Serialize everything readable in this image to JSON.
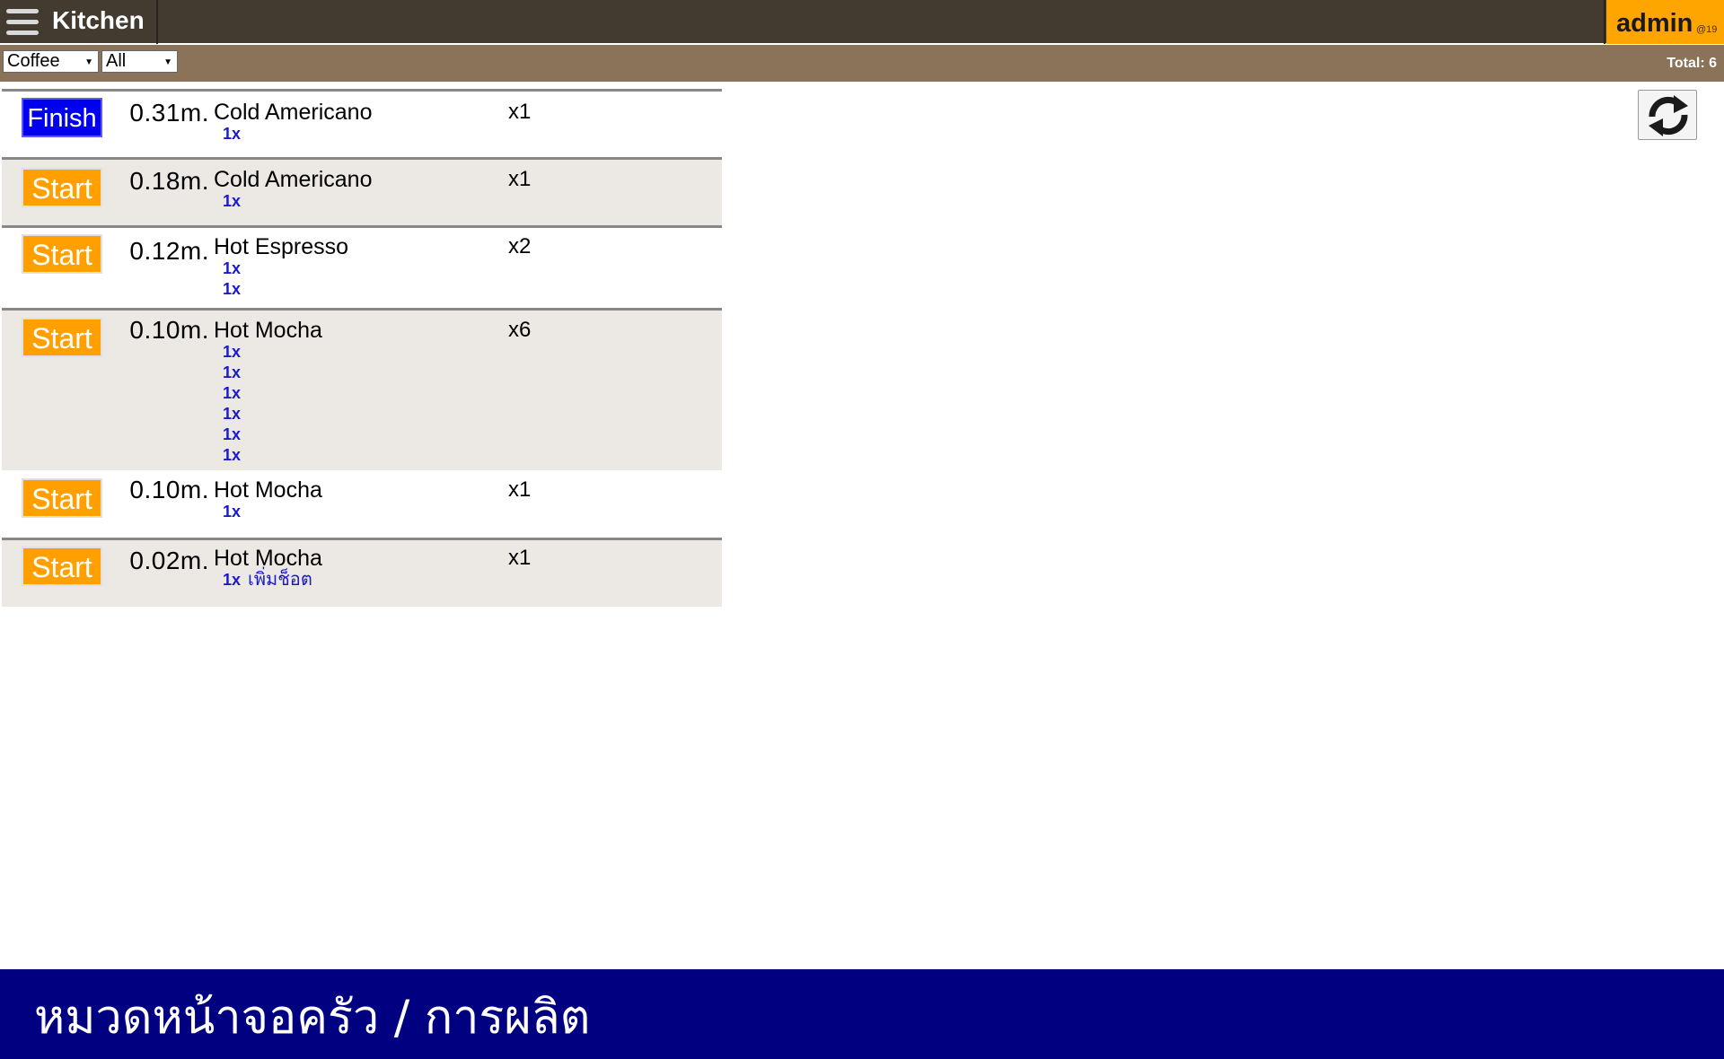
{
  "header": {
    "title": "Kitchen",
    "user": "admin",
    "user_suffix": "@19"
  },
  "filters": {
    "category": "Coffee",
    "status": "All",
    "total": "Total: 6"
  },
  "orders": [
    {
      "action": "Finish",
      "elapsed": "0.31m.",
      "item": "Cold Americano",
      "qty": "x1",
      "subs": [
        {
          "amount": "1x",
          "note": ""
        }
      ]
    },
    {
      "action": "Start",
      "elapsed": "0.18m.",
      "item": "Cold Americano",
      "qty": "x1",
      "subs": [
        {
          "amount": "1x",
          "note": ""
        }
      ]
    },
    {
      "action": "Start",
      "elapsed": "0.12m.",
      "item": "Hot Espresso",
      "qty": "x2",
      "subs": [
        {
          "amount": "1x",
          "note": ""
        },
        {
          "amount": "1x",
          "note": ""
        }
      ]
    },
    {
      "action": "Start",
      "elapsed": "0.10m.",
      "item": "Hot Mocha",
      "qty": "x6",
      "subs": [
        {
          "amount": "1x",
          "note": ""
        },
        {
          "amount": "1x",
          "note": ""
        },
        {
          "amount": "1x",
          "note": ""
        },
        {
          "amount": "1x",
          "note": ""
        },
        {
          "amount": "1x",
          "note": ""
        },
        {
          "amount": "1x",
          "note": ""
        }
      ]
    },
    {
      "action": "Start",
      "elapsed": "0.10m.",
      "item": "Hot Mocha",
      "qty": "x1",
      "subs": [
        {
          "amount": "1x",
          "note": ""
        }
      ]
    },
    {
      "action": "Start",
      "elapsed": "0.02m.",
      "item": "Hot Mocha",
      "qty": "x1",
      "subs": [
        {
          "amount": "1x",
          "note": "เพิ่มช็อต"
        }
      ]
    }
  ],
  "footer": {
    "text": "หมวดหน้าจอครัว / การผลิต"
  },
  "icons": {
    "menu": "hamburger-menu-icon",
    "refresh": "refresh-icon"
  },
  "colors": {
    "topbar": "#433a30",
    "filterbar": "#8a7358",
    "user_badge": "#ffa500",
    "finish_button": "#0000ee",
    "start_button": "#ffa000",
    "footer": "#000080"
  }
}
